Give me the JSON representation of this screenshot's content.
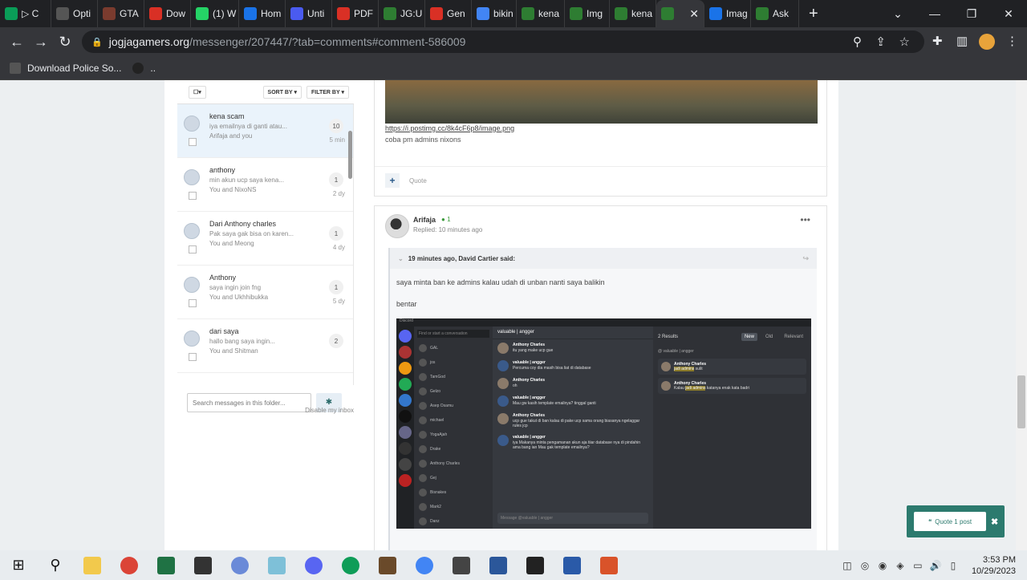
{
  "browser": {
    "tabs": [
      {
        "label": "▷ C",
        "color": "#0a9d58"
      },
      {
        "label": "Opti",
        "color": "#555"
      },
      {
        "label": "GTA",
        "color": "#7a3b2e"
      },
      {
        "label": "Dow",
        "color": "#d93025"
      },
      {
        "label": "(1) W",
        "color": "#25d366"
      },
      {
        "label": "Hom",
        "color": "#1a73e8"
      },
      {
        "label": "Unti",
        "color": "#4a5bf0"
      },
      {
        "label": "PDF",
        "color": "#d93025"
      },
      {
        "label": "JG:U",
        "color": "#2e7d32"
      },
      {
        "label": "Gen",
        "color": "#d93025"
      },
      {
        "label": "bikin",
        "color": "#4285f4"
      },
      {
        "label": "kena",
        "color": "#2e7d32"
      },
      {
        "label": "Img",
        "color": "#2e7d32"
      },
      {
        "label": "kena",
        "color": "#2e7d32"
      },
      {
        "label": "",
        "color": "#2e7d32",
        "active": true
      },
      {
        "label": "Imag",
        "color": "#1a73e8"
      },
      {
        "label": "Ask",
        "color": "#2e7d32"
      }
    ],
    "url_host": "jogjagamers.org",
    "url_path": "/messenger/207447/?tab=comments#comment-586009",
    "bookmark_label": "Download Police So...",
    "bookmark_more": ".."
  },
  "messenger": {
    "sort_by": "SORT BY",
    "filter_by": "FILTER BY",
    "conversations": [
      {
        "title": "kena scam",
        "snippet": "iya emailnya di ganti atau...",
        "participants": "Arifaja and you",
        "count": "10",
        "age": "5 min"
      },
      {
        "title": "anthony",
        "snippet": "min akun ucp saya kena...",
        "participants": "You and NixoNS",
        "count": "1",
        "age": "2 dy"
      },
      {
        "title": "Dari Anthony charles",
        "snippet": "Pak saya gak bisa on karen...",
        "participants": "You and Meong",
        "count": "1",
        "age": "4 dy"
      },
      {
        "title": "Anthony",
        "snippet": "saya ingin join fng",
        "participants": "You and Ukhhibukka",
        "count": "1",
        "age": "5 dy"
      },
      {
        "title": "dari saya",
        "snippet": "hallo bang saya ingin...",
        "participants": "You and Shitman",
        "count": "2",
        "age": ""
      }
    ],
    "search_placeholder": "Search messages in this folder...",
    "disable_inbox": "Disable my inbox"
  },
  "posts": {
    "first": {
      "image_link": "https://i.postimg.cc/8k4cF6p8/image.png",
      "text": "coba pm admins nixons",
      "quote_label": "Quote"
    },
    "second": {
      "author": "Arifaja",
      "reputation": "1",
      "replied": "Replied: 10 minutes ago",
      "quote_header": "19 minutes ago, David Cartier said:",
      "quote_line1": "saya minta ban ke admins kalau udah di unban nanti saya balikin",
      "quote_line2": "bentar"
    }
  },
  "discord": {
    "titlebar": "Discord",
    "search_conv": "Find or start a conversation",
    "channel_header": "valuable | angger",
    "dms": [
      "GAL",
      "jos",
      "TamGod",
      "Gelzo",
      "Asep Osamu",
      "michael",
      "YogaAjah",
      "Drake",
      "Anthony Charles",
      "Gej",
      "Bisnakes",
      "Mark2",
      "Danz"
    ],
    "messages": [
      {
        "name": "Anthony Charles",
        "text": "itu yang make ucp gue"
      },
      {
        "name": "valuable | angger",
        "text": "Percuma coy dia masih bisa liat di database"
      },
      {
        "name": "Anthony Charles",
        "text": "oh"
      },
      {
        "name": "valuable | angger",
        "text": "Mau gw kasih template emailnya? tinggal ganti"
      },
      {
        "name": "Anthony Charles",
        "text": "ucp gue takut di ban kalau di pake ucp sama orang biasanya ngelaggar rules jcp"
      },
      {
        "name": "valuable | angger",
        "text": "iya Makanya minta pengamanan akun aja tiiar database nya di pindahin ama bang ian Mau gak template emailnya?"
      }
    ],
    "input_placeholder": "Message @valuable | angger",
    "results_count": "2 Results",
    "results_tabs": [
      "New",
      "Old",
      "Relevant"
    ],
    "results_channel": "@ valuable | angger",
    "results": [
      {
        "name": "Anthony Charles",
        "pre": "",
        "hl": "jadi admins",
        "post": " sulit"
      },
      {
        "name": "Anthony Charles",
        "pre": "Kalau ",
        "hl": "jadi admins",
        "post": " katanya enak kata badri"
      }
    ]
  },
  "quote_popup": {
    "label": "Quote 1 post"
  },
  "taskbar": {
    "time": "3:53 PM",
    "date": "10/29/2023"
  }
}
